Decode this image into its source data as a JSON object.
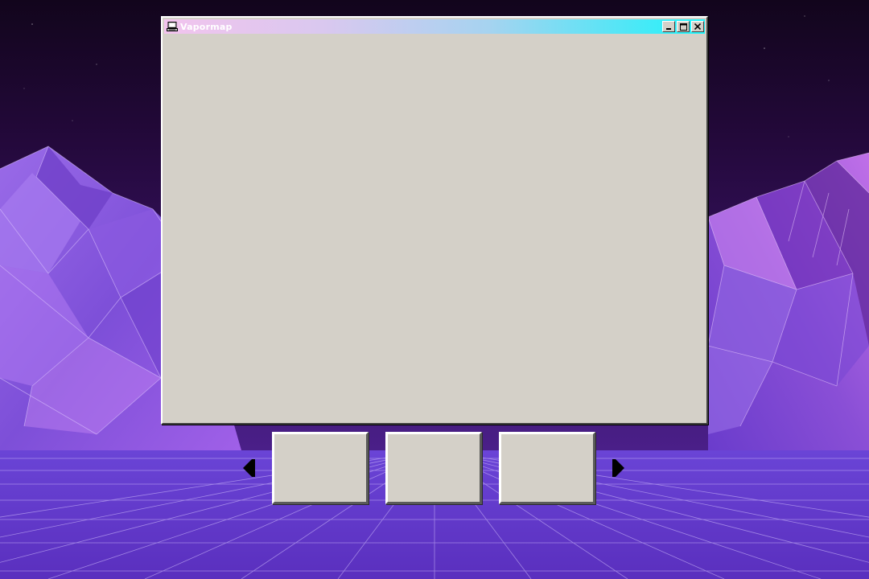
{
  "window": {
    "title": "Vapormap",
    "icon": "computer-icon",
    "controls": [
      "minimize-icon",
      "maximize-icon",
      "close-icon"
    ]
  },
  "carousel": {
    "prev_icon": "arrow-left-icon",
    "next_icon": "arrow-right-icon",
    "items": [
      "",
      "",
      ""
    ]
  },
  "colors": {
    "titlebar_start": "#f2c4ee",
    "titlebar_end": "#1ff5fb",
    "window_face": "#d4d0c8",
    "background_purple": "#5b2bb6"
  }
}
